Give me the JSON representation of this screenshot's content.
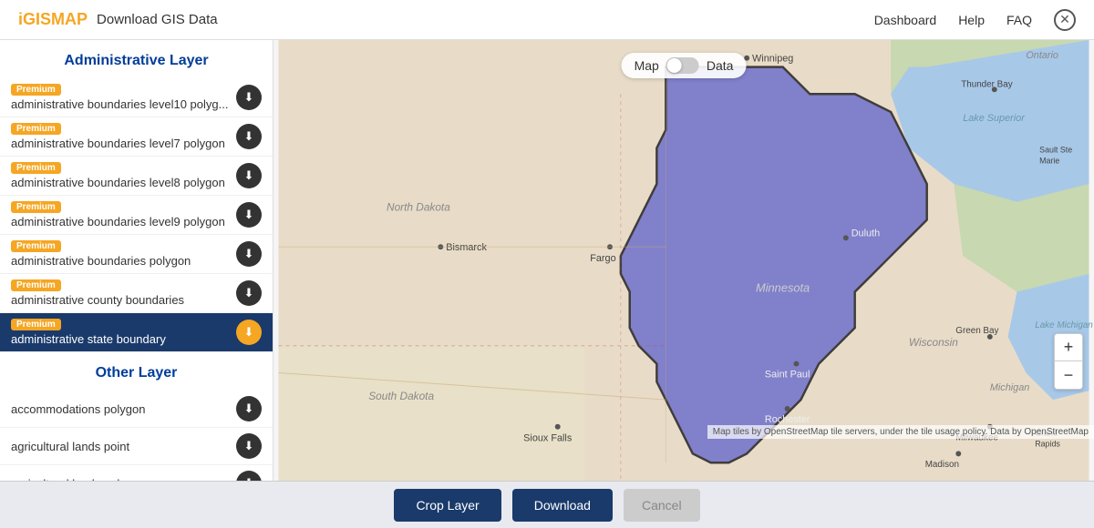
{
  "header": {
    "logo_i": "i",
    "logo_rest": "GISMAP",
    "title": "Download GIS Data",
    "nav": [
      "Dashboard",
      "Help",
      "FAQ"
    ]
  },
  "sidebar": {
    "admin_section_title": "Administrative Layer",
    "other_section_title": "Other Layer",
    "admin_layers": [
      {
        "id": 1,
        "premium": true,
        "name": "administrative boundaries level10 polyg...",
        "active": false
      },
      {
        "id": 2,
        "premium": true,
        "name": "administrative boundaries level7 polygon",
        "active": false
      },
      {
        "id": 3,
        "premium": true,
        "name": "administrative boundaries level8 polygon",
        "active": false
      },
      {
        "id": 4,
        "premium": true,
        "name": "administrative boundaries level9 polygon",
        "active": false
      },
      {
        "id": 5,
        "premium": true,
        "name": "administrative boundaries polygon",
        "active": false
      },
      {
        "id": 6,
        "premium": true,
        "name": "administrative county boundaries",
        "active": false
      },
      {
        "id": 7,
        "premium": true,
        "name": "administrative state boundary",
        "active": true
      }
    ],
    "other_layers": [
      {
        "id": 8,
        "name": "accommodations polygon",
        "active": false
      },
      {
        "id": 9,
        "name": "agricultural lands point",
        "active": false
      },
      {
        "id": 10,
        "name": "agricultural lands polygon",
        "active": false
      }
    ],
    "premium_label": "Premium"
  },
  "map": {
    "toggle_map_label": "Map",
    "toggle_data_label": "Data",
    "attribution": "Map tiles by OpenStreetMap tile servers, under the tile usage policy. Data by OpenStreetMap"
  },
  "bottom_bar": {
    "crop_label": "Crop Layer",
    "download_label": "Download",
    "cancel_label": "Cancel"
  },
  "icons": {
    "download": "⬇",
    "close": "✕",
    "zoom_in": "+",
    "zoom_out": "−"
  }
}
